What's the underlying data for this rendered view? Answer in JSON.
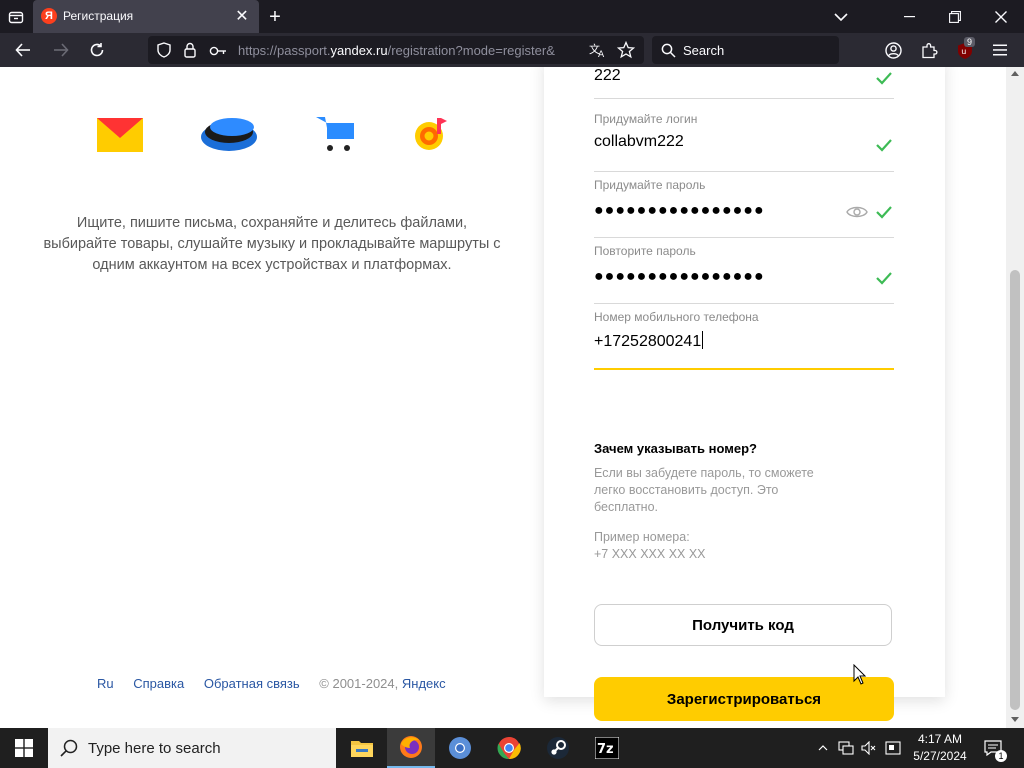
{
  "browser": {
    "tab_title": "Регистрация",
    "tab_favicon_letter": "Я",
    "url_prefix": "https://passport.",
    "url_domain": "yandex.ru",
    "url_suffix": "/registration?mode=register&",
    "search_placeholder": "Search",
    "extension_badge": "9"
  },
  "left_panel": {
    "promo_text": "Ищите, пишите письма, сохраняйте и делитесь файлами, выбирайте товары, слушайте музыку и прокладывайте маршруты с одним аккаунтом на всех устройствах и платформах.",
    "footer": {
      "lang": "Ru",
      "help": "Справка",
      "feedback": "Обратная связь",
      "copyright": "© 2001-2024,",
      "brand": "Яндекс"
    }
  },
  "form": {
    "lastname_value": "222",
    "login_label": "Придумайте логин",
    "login_value": "collabvm222",
    "password_label": "Придумайте пароль",
    "password_value": "●●●●●●●●●●●●●●●●",
    "password_repeat_label": "Повторите пароль",
    "password_repeat_value": "●●●●●●●●●●●●●●●●",
    "phone_label": "Номер мобильного телефона",
    "phone_value": "+17252800241",
    "help_title": "Зачем указывать номер?",
    "help_text": "Если вы забудете пароль, то сможете легко восстановить доступ. Это бесплатно.",
    "example_label": "Пример номера:",
    "example_value": "+7 XXX XXX XX XX",
    "get_code_button": "Получить код",
    "register_button": "Зарегистрироваться"
  },
  "taskbar": {
    "search_placeholder": "Type here to search",
    "time": "4:17 AM",
    "date": "5/27/2024"
  },
  "colors": {
    "accent_yellow": "#ffcc00",
    "check_green": "#3dbb55",
    "link_blue": "#2a57a3"
  }
}
